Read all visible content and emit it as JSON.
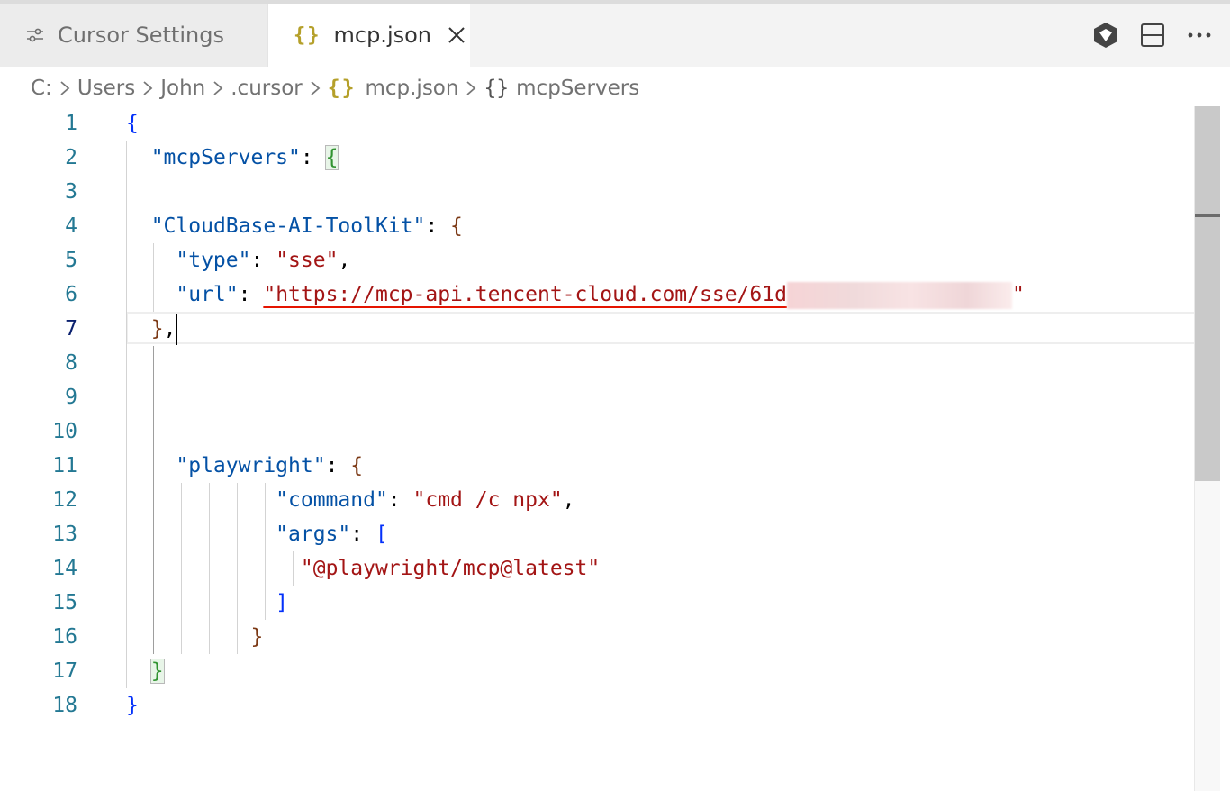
{
  "tabs": {
    "settings_label": "Cursor Settings",
    "file_label": "mcp.json",
    "json_glyph": "{}"
  },
  "breadcrumb": {
    "items": [
      "C:",
      "Users",
      "John",
      ".cursor",
      "mcp.json",
      "mcpServers"
    ],
    "json_glyph": "{}",
    "object_glyph": "{}"
  },
  "editor": {
    "line_numbers": [
      "1",
      "2",
      "3",
      "4",
      "5",
      "6",
      "7",
      "8",
      "9",
      "10",
      "11",
      "12",
      "13",
      "14",
      "15",
      "16",
      "17",
      "18"
    ],
    "active_line": "7",
    "tokens": {
      "l2_key": "\"mcpServers\"",
      "l4_key": "\"CloudBase-AI-ToolKit\"",
      "l5_key": "\"type\"",
      "l5_val": "\"sse\"",
      "l6_key": "\"url\"",
      "l6_val": "\"https://mcp-api.tencent-cloud.com/sse/61d",
      "l6_end": "\"",
      "l11_key": "\"playwright\"",
      "l12_key": "\"command\"",
      "l12_val": "\"cmd /c npx\"",
      "l13_key": "\"args\"",
      "l14_val": "\"@playwright/mcp@latest\""
    }
  },
  "icons": {
    "settings": "settings-sliders-icon",
    "close": "close-icon",
    "cursor": "cursor-logo-icon",
    "split": "split-editor-icon",
    "more": "more-actions-icon",
    "chevron": "chevron-right-icon"
  }
}
